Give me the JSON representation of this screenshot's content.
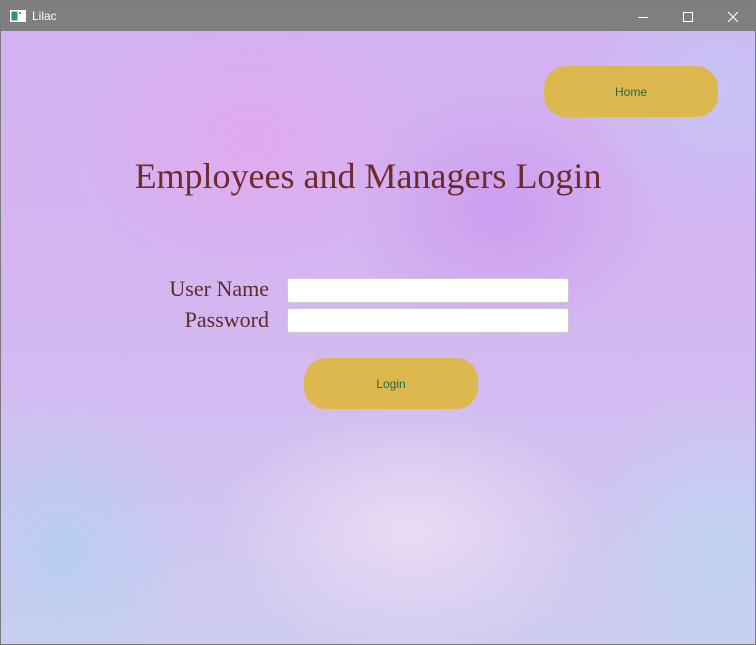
{
  "window": {
    "title": "Lilac",
    "titlebar_color": "#7f7f7f"
  },
  "nav": {
    "home_label": "Home"
  },
  "page": {
    "title": "Employees and Managers Login"
  },
  "form": {
    "username_label": "User Name",
    "username_value": "",
    "password_label": "Password",
    "password_value": "",
    "login_label": "Login"
  },
  "colors": {
    "button_bg": "#ddb84f",
    "button_text": "#1f6b4a",
    "heading_text": "#6e2a2c"
  },
  "icons": {
    "app": "app-window-icon",
    "minimize": "minimize-icon",
    "maximize": "maximize-icon",
    "close": "close-icon"
  }
}
